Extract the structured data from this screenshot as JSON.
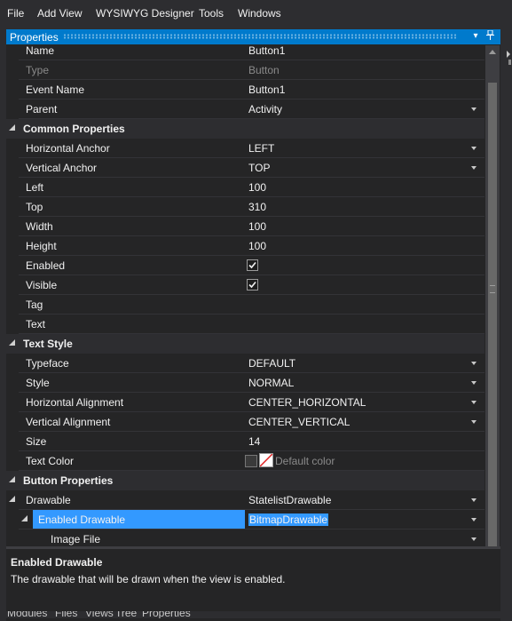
{
  "menu": [
    "File",
    "Add View",
    "WYSIWYG Designer",
    "Tools",
    "Windows"
  ],
  "panel": {
    "title": "Properties",
    "pin_icon": "pin-icon",
    "dropdown_icon": "chevron-down-icon"
  },
  "rows": [
    {
      "kind": "prop",
      "name": "Name",
      "value": "Button1"
    },
    {
      "kind": "prop",
      "name": "Type",
      "value": "Button",
      "dim": true
    },
    {
      "kind": "prop",
      "name": "Event Name",
      "value": "Button1"
    },
    {
      "kind": "prop",
      "name": "Parent",
      "value": "Activity",
      "dropdown": true
    },
    {
      "kind": "cat",
      "name": "Common Properties"
    },
    {
      "kind": "prop",
      "name": "Horizontal Anchor",
      "value": "LEFT",
      "dropdown": true
    },
    {
      "kind": "prop",
      "name": "Vertical Anchor",
      "value": "TOP",
      "dropdown": true
    },
    {
      "kind": "prop",
      "name": "Left",
      "value": "100"
    },
    {
      "kind": "prop",
      "name": "Top",
      "value": "310"
    },
    {
      "kind": "prop",
      "name": "Width",
      "value": "100"
    },
    {
      "kind": "prop",
      "name": "Height",
      "value": "100"
    },
    {
      "kind": "prop",
      "name": "Enabled",
      "check": true
    },
    {
      "kind": "prop",
      "name": "Visible",
      "check": true
    },
    {
      "kind": "prop",
      "name": "Tag",
      "value": ""
    },
    {
      "kind": "prop",
      "name": "Text",
      "value": ""
    },
    {
      "kind": "cat",
      "name": "Text Style"
    },
    {
      "kind": "prop",
      "name": "Typeface",
      "value": "DEFAULT",
      "dropdown": true
    },
    {
      "kind": "prop",
      "name": "Style",
      "value": "NORMAL",
      "dropdown": true
    },
    {
      "kind": "prop",
      "name": "Horizontal Alignment",
      "value": "CENTER_HORIZONTAL",
      "dropdown": true
    },
    {
      "kind": "prop",
      "name": "Vertical Alignment",
      "value": "CENTER_VERTICAL",
      "dropdown": true
    },
    {
      "kind": "prop",
      "name": "Size",
      "value": "14"
    },
    {
      "kind": "prop",
      "name": "Text Color",
      "value": "Default color",
      "color": true,
      "dim": true
    },
    {
      "kind": "cat",
      "name": "Button Properties"
    },
    {
      "kind": "prop",
      "name": "Drawable",
      "value": "StatelistDrawable",
      "dropdown": true,
      "expand": true
    },
    {
      "kind": "prop",
      "name": "Enabled Drawable",
      "value": "BitmapDrawable",
      "dropdown": true,
      "expand": true,
      "level": 1,
      "selected": true
    },
    {
      "kind": "prop",
      "name": "Image File",
      "value": "",
      "dropdown": true,
      "level": 2
    }
  ],
  "description": {
    "title": "Enabled Drawable",
    "text": "The drawable that will be drawn when the view is enabled."
  },
  "bottom_tabs": [
    "Modules",
    "Files",
    "Views",
    "Tree",
    "Properties"
  ],
  "colors": {
    "accent": "#007acc",
    "selection": "#3399ff",
    "background": "#252526"
  }
}
